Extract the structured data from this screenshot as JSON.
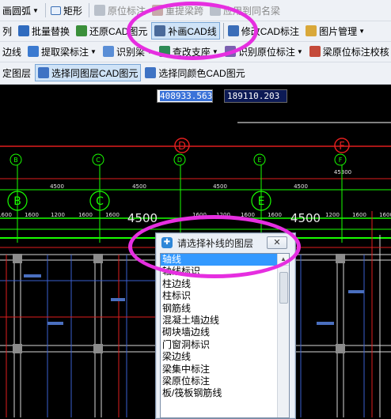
{
  "toolbar": {
    "row1": {
      "arc_label": "画圆弧",
      "rect_label": "矩形",
      "origin_label": "原位标注",
      "relift_label": "重提梁跨",
      "apply_same_label": "应用到同名梁"
    },
    "row2": {
      "col_label": "列",
      "batch_replace_label": "批量替换",
      "restore_cad_label": "还原CAD图元",
      "redraw_cad_label": "补画CAD线",
      "modify_annot_label": "修改CAD标注",
      "image_mgmt_label": "图片管理"
    },
    "row3": {
      "edge_label": "边线",
      "extract_beam_label": "提取梁标注",
      "identify_label": "识别梁",
      "check_support_label": "查改支座",
      "identify_origin_label": "识别原位标注",
      "beam_origin_check_label": "梁原位标注校核"
    },
    "row4": {
      "layer_label": "定图层",
      "select_same_layer_label": "选择同图层CAD图元",
      "select_same_color_label": "选择同颜色CAD图元"
    }
  },
  "canvas": {
    "coord_x": "408933.563",
    "coord_y": "189110.203",
    "axis_labels_top": [
      "D",
      "F"
    ],
    "axis_circle_labels": [
      "B",
      "C",
      "D",
      "E",
      "F"
    ],
    "axis_row_labels": [
      "B",
      "C",
      "E"
    ],
    "dim_top": "45300",
    "dim_4500": "4500",
    "dim_1600": "1600",
    "dim_1200": "1200",
    "dim_large": "4500"
  },
  "dialog": {
    "title": "请选择补线的图层",
    "close_label": "✕",
    "layers": [
      "轴线",
      "轴线标识",
      "柱边线",
      "柱标识",
      "钢筋线",
      "混凝土墙边线",
      "砌块墙边线",
      "门窗洞标识",
      "梁边线",
      "梁集中标注",
      "梁原位标注",
      "板/筏板钢筋线"
    ],
    "selected_index": 0
  },
  "colors": {
    "toolbar_bg": "#eef1f6",
    "axis_green": "#19ff00",
    "axis_red": "#e01e1e",
    "highlight": "#e62ee0",
    "selection": "#3399ff"
  }
}
